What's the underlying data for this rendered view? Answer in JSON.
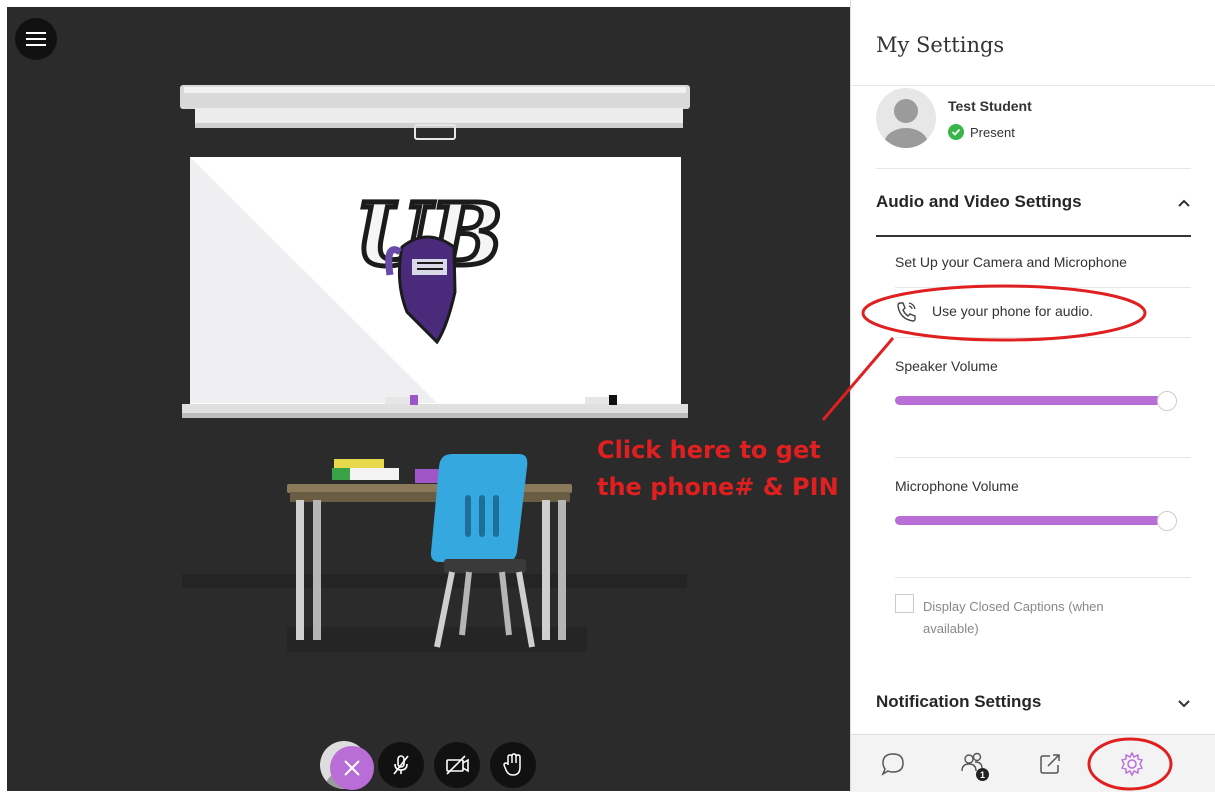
{
  "panel": {
    "title": "My Settings",
    "user": {
      "name": "Test Student",
      "status": "Present"
    },
    "audio_video": {
      "title": "Audio and Video Settings",
      "setup_label": "Set Up your Camera and Microphone",
      "phone_label": "Use your phone for audio.",
      "speaker_label": "Speaker Volume",
      "speaker_level": 0.95,
      "microphone_label": "Microphone Volume",
      "microphone_level": 0.95
    },
    "captions_label": "Display Closed Captions (when available)",
    "notification_title": "Notification Settings",
    "participants_badge": "1"
  },
  "annotation": {
    "text": "Click here to get\nthe phone# & PIN"
  },
  "colors": {
    "accent": "#b86ed6",
    "annotation": "#e02020",
    "present": "#3ab54a",
    "stage": "#2b2b2b"
  },
  "icons": [
    "hamburger-menu-icon",
    "microphone-muted-icon",
    "camera-off-icon",
    "raise-hand-icon",
    "phone-icon",
    "chat-icon",
    "participants-icon",
    "share-icon",
    "gear-icon",
    "close-icon"
  ]
}
